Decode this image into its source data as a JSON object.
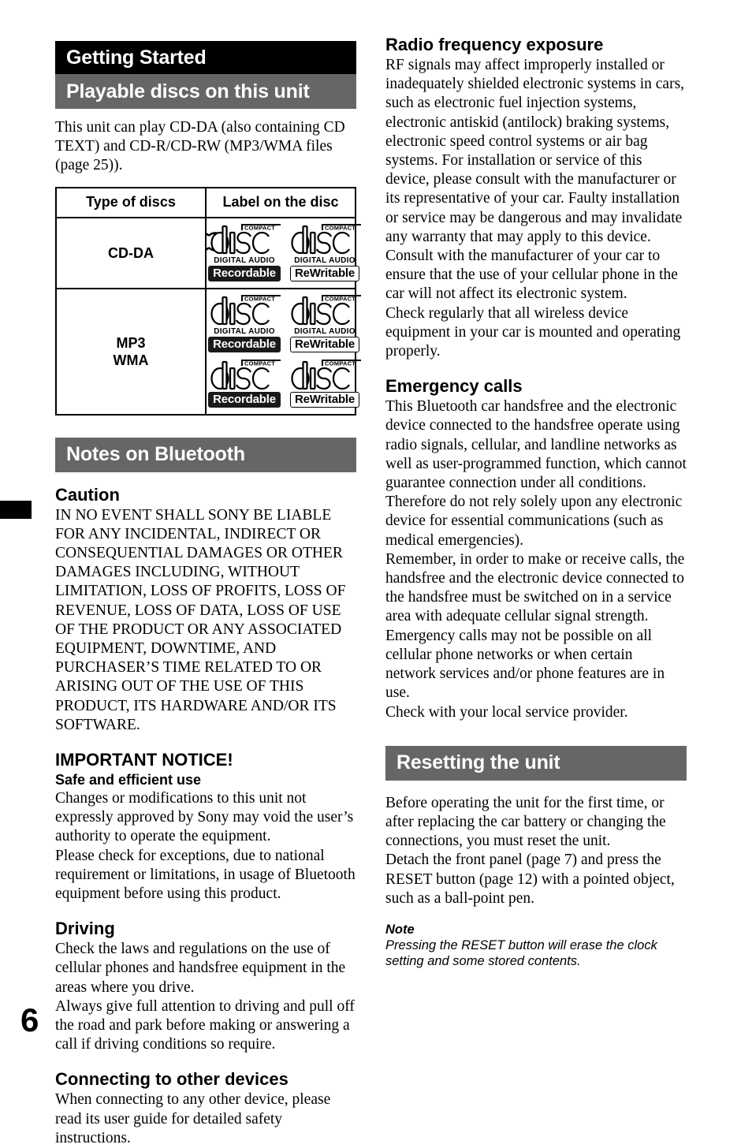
{
  "page": {
    "folio": "6"
  },
  "left_column": {
    "chapter_banner": "Getting Started",
    "section_banner": "Playable discs on this unit",
    "intro": "This unit can play CD-DA (also containing CD TEXT) and CD-R/CD-RW (MP3/WMA files (page 25)).",
    "disc_table": {
      "headers": [
        "Type of discs",
        "Label on the disc"
      ],
      "rows": [
        {
          "type": "CD-DA",
          "logo_rows": [
            [
              {
                "top": "COMPACT",
                "mark": "disc",
                "tagline": "DIGITAL AUDIO",
                "badge": "Recordable",
                "badge_style": "solid"
              },
              {
                "top": "COMPACT",
                "mark": "disc",
                "tagline": "DIGITAL AUDIO",
                "badge": "ReWritable",
                "badge_style": "outline"
              }
            ]
          ]
        },
        {
          "type_line1": "MP3",
          "type_line2": "WMA",
          "logo_rows": [
            [
              {
                "top": "COMPACT",
                "mark": "disc",
                "tagline": "DIGITAL AUDIO",
                "badge": "Recordable",
                "badge_style": "solid"
              },
              {
                "top": "COMPACT",
                "mark": "disc",
                "tagline": "DIGITAL AUDIO",
                "badge": "ReWritable",
                "badge_style": "outline"
              }
            ],
            [
              {
                "top": "COMPACT",
                "mark": "disc",
                "tagline": "",
                "badge": "Recordable",
                "badge_style": "solid"
              },
              {
                "top": "COMPACT",
                "mark": "disc",
                "tagline": "",
                "badge": "ReWritable",
                "badge_style": "outline"
              }
            ]
          ]
        }
      ]
    },
    "bluetooth_banner": "Notes on Bluetooth",
    "caution": {
      "heading": "Caution",
      "body": "IN NO EVENT SHALL SONY BE LIABLE FOR ANY INCIDENTAL, INDIRECT OR CONSEQUENTIAL DAMAGES OR OTHER DAMAGES INCLUDING, WITHOUT LIMITATION, LOSS OF PROFITS, LOSS OF REVENUE, LOSS OF DATA, LOSS OF USE OF THE PRODUCT OR ANY ASSOCIATED EQUIPMENT, DOWNTIME, AND PURCHASER’S TIME RELATED TO OR ARISING OUT OF THE USE OF THIS PRODUCT, ITS HARDWARE AND/OR ITS SOFTWARE."
    },
    "important_notice": {
      "heading": "IMPORTANT NOTICE!",
      "subheading": "Safe and efficient use",
      "para1": "Changes or modifications to this unit not expressly approved by Sony may void the user’s authority to operate the equipment.",
      "para2": "Please check for exceptions, due to national requirement or limitations, in usage of Bluetooth equipment before using this product."
    },
    "driving": {
      "heading": "Driving",
      "para1": "Check the laws and regulations on the use of cellular phones and handsfree equipment in the areas where you drive.",
      "para2": "Always give full attention to driving and pull off the road and park before making or answering a call if driving conditions so require."
    },
    "connecting": {
      "heading": "Connecting to other devices",
      "para1": "When connecting to any other device, please read its user guide for detailed safety instructions."
    }
  },
  "right_column": {
    "radio_frequency": {
      "heading": "Radio frequency exposure",
      "para1": "RF signals may affect improperly installed or inadequately shielded electronic systems in cars, such as electronic fuel injection systems, electronic antiskid (antilock) braking systems, electronic speed control systems or air bag systems. For installation or service of this device, please consult with the manufacturer or its representative of your car. Faulty installation or service may be dangerous and may invalidate any warranty that may apply to this device.",
      "para2": "Consult with the manufacturer of your car to ensure that the use of your cellular phone in the car will not affect its electronic system.",
      "para3": "Check regularly that all wireless device equipment in your car is mounted and operating properly."
    },
    "emergency_calls": {
      "heading": "Emergency calls",
      "para1": "This Bluetooth car handsfree and the electronic device connected to the handsfree operate using radio signals, cellular, and landline networks as well as user-programmed function, which cannot guarantee connection under all conditions.",
      "para2": "Therefore do not rely solely upon any electronic device for essential communications (such as medical emergencies).",
      "para3": "Remember, in order to make or receive calls, the handsfree and the electronic device connected to the handsfree must be switched on in a service area with adequate cellular signal strength.",
      "para4": "Emergency calls may not be possible on all cellular phone networks or when certain network services and/or phone features are in use.",
      "para5": "Check with your local service provider."
    },
    "resetting_banner": "Resetting the unit",
    "resetting": {
      "para1": "Before operating the unit for the first time, or after replacing the car battery or changing the connections, you must reset the unit.",
      "para2": "Detach the front panel (page 7) and press the RESET button (page 12) with a pointed object, such as a ball-point pen.",
      "note_heading": "Note",
      "note_body": "Pressing the RESET button will erase the clock setting and some stored contents."
    }
  },
  "colors": {
    "chapter_banner_bg": "#000000",
    "section_banner_bg": "#666666",
    "banner_text": "#ffffff",
    "body_text": "#000000",
    "badge_solid_bg": "#1a1a1a"
  }
}
